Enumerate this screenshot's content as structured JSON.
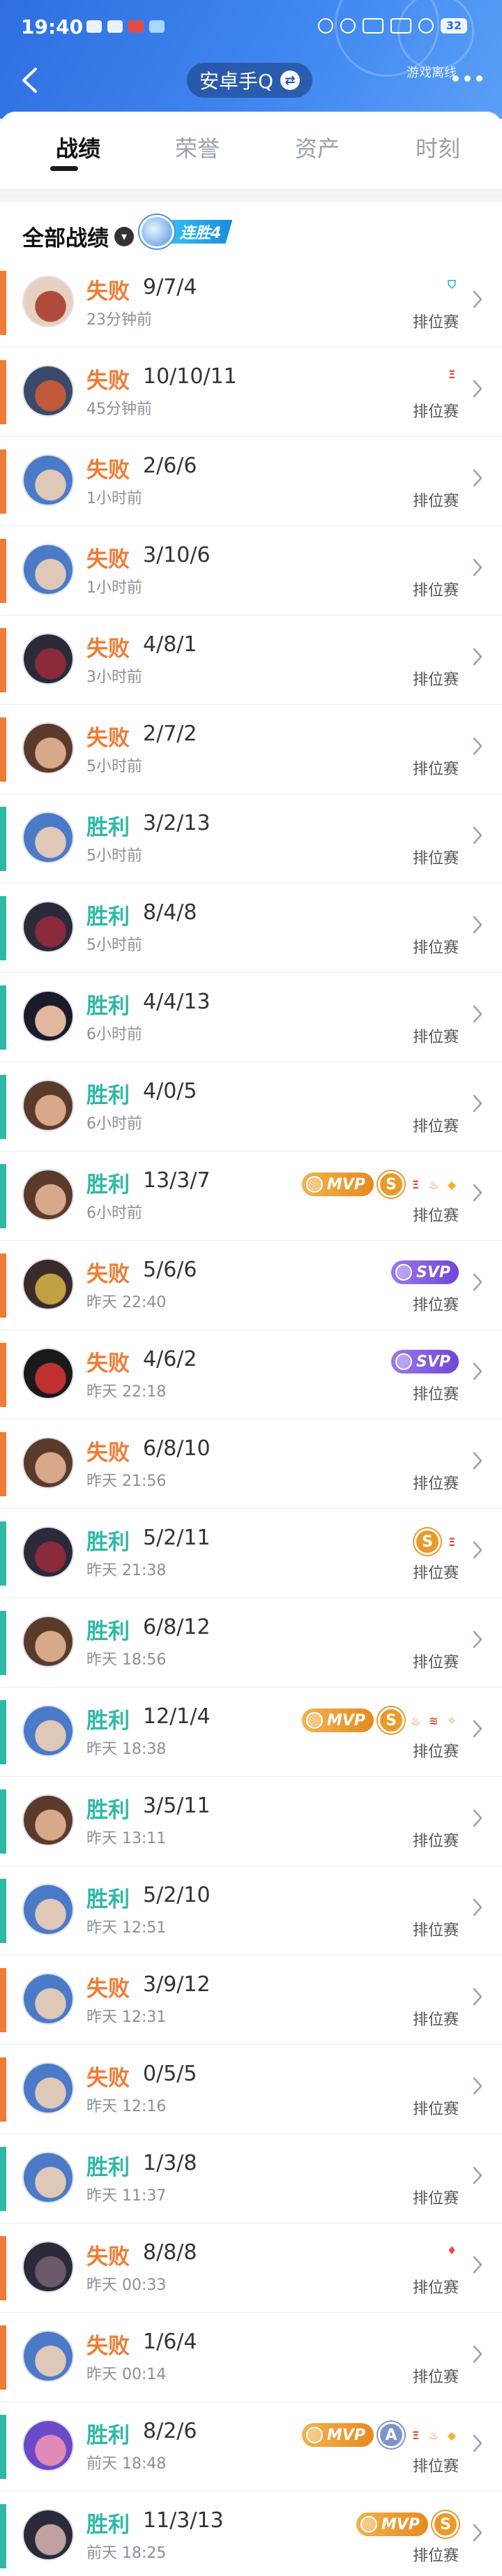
{
  "status_bar": {
    "time": "19:40",
    "battery": "32"
  },
  "header": {
    "online_status": "游戏离线",
    "account_name": "安卓手Q",
    "swap_symbol": "⇄"
  },
  "tabs": [
    {
      "label": "战绩",
      "active": true
    },
    {
      "label": "荣誉",
      "active": false
    },
    {
      "label": "资产",
      "active": false
    },
    {
      "label": "时刻",
      "active": false
    }
  ],
  "filter": {
    "label": "全部战绩",
    "streak_label": "连胜4"
  },
  "colors": {
    "win": "#2eb9a6",
    "lose": "#f07b35",
    "accent": "#2f6fe0"
  },
  "matches": [
    {
      "result": "失败",
      "outcome": "lose",
      "kda": "9/7/4",
      "time": "23分钟前",
      "mode": "排位赛",
      "badges": [
        "shield-icon"
      ],
      "avatar_colors": [
        "#e8d0c0",
        "#b04a3a"
      ]
    },
    {
      "result": "失败",
      "outcome": "lose",
      "kda": "10/10/11",
      "time": "45分钟前",
      "mode": "排位赛",
      "badges": [
        "triple-icon"
      ],
      "avatar_colors": [
        "#3a4a6a",
        "#c05a3a"
      ]
    },
    {
      "result": "失败",
      "outcome": "lose",
      "kda": "2/6/6",
      "time": "1小时前",
      "mode": "排位赛",
      "badges": [],
      "avatar_colors": [
        "#4a7ac8",
        "#e0c8b8"
      ]
    },
    {
      "result": "失败",
      "outcome": "lose",
      "kda": "3/10/6",
      "time": "1小时前",
      "mode": "排位赛",
      "badges": [],
      "avatar_colors": [
        "#4a7ac8",
        "#e0c8b8"
      ]
    },
    {
      "result": "失败",
      "outcome": "lose",
      "kda": "4/8/1",
      "time": "3小时前",
      "mode": "排位赛",
      "badges": [],
      "avatar_colors": [
        "#2a2a3a",
        "#8a2a3a"
      ]
    },
    {
      "result": "失败",
      "outcome": "lose",
      "kda": "2/7/2",
      "time": "5小时前",
      "mode": "排位赛",
      "badges": [],
      "avatar_colors": [
        "#5a3a2a",
        "#d8a88a"
      ]
    },
    {
      "result": "胜利",
      "outcome": "win",
      "kda": "3/2/13",
      "time": "5小时前",
      "mode": "排位赛",
      "badges": [],
      "avatar_colors": [
        "#4a7ac8",
        "#e0c8b8"
      ]
    },
    {
      "result": "胜利",
      "outcome": "win",
      "kda": "8/4/8",
      "time": "5小时前",
      "mode": "排位赛",
      "badges": [],
      "avatar_colors": [
        "#2a2a3a",
        "#8a2a3a"
      ]
    },
    {
      "result": "胜利",
      "outcome": "win",
      "kda": "4/4/13",
      "time": "6小时前",
      "mode": "排位赛",
      "badges": [],
      "avatar_colors": [
        "#1a1a2a",
        "#e0b8a0"
      ]
    },
    {
      "result": "胜利",
      "outcome": "win",
      "kda": "4/0/5",
      "time": "6小时前",
      "mode": "排位赛",
      "badges": [],
      "avatar_colors": [
        "#5a3a2a",
        "#d8a88a"
      ]
    },
    {
      "result": "胜利",
      "outcome": "win",
      "kda": "13/3/7",
      "time": "6小时前",
      "mode": "排位赛",
      "badges": [
        "MVP",
        "S",
        "triple-icon",
        "fire-icon",
        "gold-icon"
      ],
      "avatar_colors": [
        "#5a3a2a",
        "#d8a88a"
      ]
    },
    {
      "result": "失败",
      "outcome": "lose",
      "kda": "5/6/6",
      "time": "昨天 22:40",
      "mode": "排位赛",
      "badges": [
        "SVP"
      ],
      "avatar_colors": [
        "#3a2a2a",
        "#c0a040"
      ]
    },
    {
      "result": "失败",
      "outcome": "lose",
      "kda": "4/6/2",
      "time": "昨天 22:18",
      "mode": "排位赛",
      "badges": [
        "SVP"
      ],
      "avatar_colors": [
        "#1a1a1a",
        "#c03030"
      ]
    },
    {
      "result": "失败",
      "outcome": "lose",
      "kda": "6/8/10",
      "time": "昨天 21:56",
      "mode": "排位赛",
      "badges": [],
      "avatar_colors": [
        "#5a3a2a",
        "#d8a88a"
      ]
    },
    {
      "result": "胜利",
      "outcome": "win",
      "kda": "5/2/11",
      "time": "昨天 21:38",
      "mode": "排位赛",
      "badges": [
        "S",
        "triple-icon"
      ],
      "avatar_colors": [
        "#2a2a3a",
        "#8a2a3a"
      ]
    },
    {
      "result": "胜利",
      "outcome": "win",
      "kda": "6/8/12",
      "time": "昨天 18:56",
      "mode": "排位赛",
      "badges": [],
      "avatar_colors": [
        "#5a3a2a",
        "#d8a88a"
      ]
    },
    {
      "result": "胜利",
      "outcome": "win",
      "kda": "12/1/4",
      "time": "昨天 18:38",
      "mode": "排位赛",
      "badges": [
        "MVP",
        "S",
        "fire-icon",
        "wind-icon",
        "sparkle-icon"
      ],
      "avatar_colors": [
        "#4a7ac8",
        "#e0c8b8"
      ]
    },
    {
      "result": "胜利",
      "outcome": "win",
      "kda": "3/5/11",
      "time": "昨天 13:11",
      "mode": "排位赛",
      "badges": [],
      "avatar_colors": [
        "#5a3a2a",
        "#d8a88a"
      ]
    },
    {
      "result": "胜利",
      "outcome": "win",
      "kda": "5/2/10",
      "time": "昨天 12:51",
      "mode": "排位赛",
      "badges": [],
      "avatar_colors": [
        "#4a7ac8",
        "#e0c8b8"
      ]
    },
    {
      "result": "失败",
      "outcome": "lose",
      "kda": "3/9/12",
      "time": "昨天 12:31",
      "mode": "排位赛",
      "badges": [],
      "avatar_colors": [
        "#4a7ac8",
        "#e0c8b8"
      ]
    },
    {
      "result": "失败",
      "outcome": "lose",
      "kda": "0/5/5",
      "time": "昨天 12:16",
      "mode": "排位赛",
      "badges": [],
      "avatar_colors": [
        "#4a7ac8",
        "#e0c8b8"
      ]
    },
    {
      "result": "胜利",
      "outcome": "win",
      "kda": "1/3/8",
      "time": "昨天 11:37",
      "mode": "排位赛",
      "badges": [],
      "avatar_colors": [
        "#4a7ac8",
        "#e0c8b8"
      ]
    },
    {
      "result": "失败",
      "outcome": "lose",
      "kda": "8/8/8",
      "time": "昨天 00:33",
      "mode": "排位赛",
      "badges": [
        "drop-icon"
      ],
      "avatar_colors": [
        "#2a2a3a",
        "#6a5a6a"
      ]
    },
    {
      "result": "失败",
      "outcome": "lose",
      "kda": "1/6/4",
      "time": "昨天 00:14",
      "mode": "排位赛",
      "badges": [],
      "avatar_colors": [
        "#4a7ac8",
        "#e0c8b8"
      ]
    },
    {
      "result": "胜利",
      "outcome": "win",
      "kda": "8/2/6",
      "time": "前天 18:48",
      "mode": "排位赛",
      "badges": [
        "MVP",
        "A",
        "triple-icon",
        "fire-icon",
        "gold-icon"
      ],
      "avatar_colors": [
        "#6a4ac8",
        "#e08ab8"
      ]
    },
    {
      "result": "胜利",
      "outcome": "win",
      "kda": "11/3/13",
      "time": "前天 18:25",
      "mode": "排位赛",
      "badges": [
        "MVP",
        "S"
      ],
      "avatar_colors": [
        "#2a2a3a",
        "#c0a0a0"
      ]
    }
  ]
}
